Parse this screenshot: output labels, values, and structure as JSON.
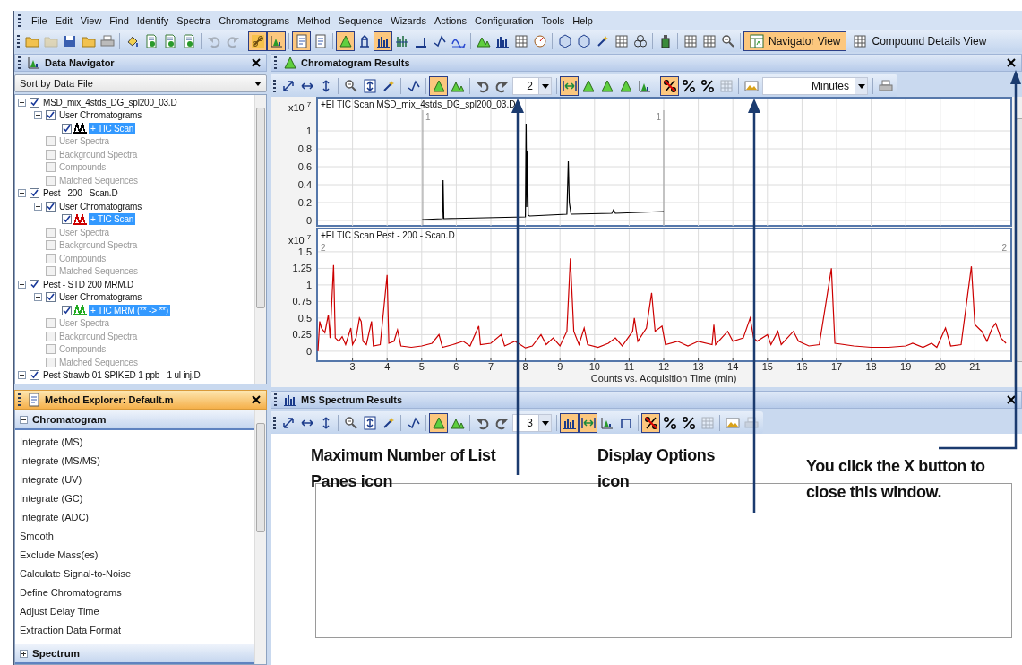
{
  "menu": [
    "File",
    "Edit",
    "View",
    "Find",
    "Identify",
    "Spectra",
    "Chromatograms",
    "Method",
    "Sequence",
    "Wizards",
    "Actions",
    "Configuration",
    "Tools",
    "Help"
  ],
  "main_toolbar": [
    {
      "items": [
        {
          "kind": "icon",
          "selected": false,
          "disabled": false
        },
        {
          "kind": "icon",
          "selected": false,
          "disabled": true
        },
        {
          "kind": "icon",
          "selected": false,
          "disabled": false
        },
        {
          "kind": "icon",
          "selected": false,
          "disabled": false
        },
        {
          "kind": "icon",
          "selected": false,
          "disabled": false
        }
      ]
    },
    {
      "items": [
        {
          "kind": "icon",
          "selected": false,
          "disabled": false
        },
        {
          "kind": "icon",
          "selected": false,
          "disabled": false
        },
        {
          "kind": "icon",
          "selected": false,
          "disabled": false
        },
        {
          "kind": "icon",
          "selected": false,
          "disabled": false
        }
      ]
    },
    {
      "items": [
        {
          "kind": "icon",
          "selected": false,
          "disabled": true
        },
        {
          "kind": "icon",
          "selected": false,
          "disabled": true
        }
      ]
    },
    {
      "items": [
        {
          "kind": "icon",
          "selected": true,
          "disabled": false
        },
        {
          "kind": "icon",
          "selected": true,
          "disabled": false
        }
      ]
    },
    {
      "items": [
        {
          "kind": "icon",
          "selected": true,
          "disabled": false
        },
        {
          "kind": "icon",
          "selected": false,
          "disabled": false
        }
      ]
    },
    {
      "items": [
        {
          "kind": "icon",
          "selected": true,
          "disabled": false
        },
        {
          "kind": "icon",
          "selected": false,
          "disabled": false
        },
        {
          "kind": "icon",
          "selected": true,
          "disabled": false
        },
        {
          "kind": "icon",
          "selected": false,
          "disabled": false
        },
        {
          "kind": "icon",
          "selected": false,
          "disabled": false
        },
        {
          "kind": "icon",
          "selected": false,
          "disabled": false
        },
        {
          "kind": "icon",
          "selected": false,
          "disabled": false
        }
      ]
    },
    {
      "items": [
        {
          "kind": "icon",
          "selected": false,
          "disabled": false
        },
        {
          "kind": "icon",
          "selected": false,
          "disabled": false
        },
        {
          "kind": "icon",
          "selected": false,
          "disabled": false
        },
        {
          "kind": "icon",
          "selected": false,
          "disabled": false
        }
      ]
    },
    {
      "items": [
        {
          "kind": "icon",
          "selected": false,
          "disabled": false
        },
        {
          "kind": "icon",
          "selected": false,
          "disabled": false
        },
        {
          "kind": "icon",
          "selected": false,
          "disabled": false
        },
        {
          "kind": "icon",
          "selected": false,
          "disabled": false
        },
        {
          "kind": "icon",
          "selected": false,
          "disabled": false
        }
      ]
    },
    {
      "items": [
        {
          "kind": "icon",
          "selected": false,
          "disabled": false
        }
      ]
    },
    {
      "items": [
        {
          "kind": "icon",
          "selected": false,
          "disabled": false
        },
        {
          "kind": "icon",
          "selected": false,
          "disabled": false
        },
        {
          "kind": "icon",
          "selected": false,
          "disabled": false
        }
      ]
    },
    {
      "items": [
        {
          "kind": "button",
          "label": "Navigator View",
          "selected": true
        },
        {
          "kind": "button",
          "label": "Compound Details View",
          "selected": false
        }
      ]
    }
  ],
  "data_navigator": {
    "title": "Data Navigator",
    "active": false,
    "sort": "Sort by Data File",
    "files": [
      {
        "label": "MSD_mix_4stds_DG_spl200_03.D",
        "checked": true,
        "expanded": true,
        "selected": false,
        "disabled": false,
        "children": [
          {
            "label": "User Chromatograms",
            "checked": true,
            "expanded": true,
            "selected": false,
            "disabled": false,
            "children": [
              {
                "label": "+ TIC Scan",
                "checked": true,
                "selected": true,
                "disabled": false,
                "color": "#000000"
              }
            ]
          },
          {
            "label": "User Spectra",
            "checked": false,
            "selected": false,
            "disabled": true
          },
          {
            "label": "Background Spectra",
            "checked": false,
            "selected": false,
            "disabled": true
          },
          {
            "label": "Compounds",
            "checked": false,
            "selected": false,
            "disabled": true
          },
          {
            "label": "Matched Sequences",
            "checked": false,
            "selected": false,
            "disabled": true
          }
        ]
      },
      {
        "label": "Pest - 200 - Scan.D",
        "checked": true,
        "expanded": true,
        "selected": false,
        "disabled": false,
        "children": [
          {
            "label": "User Chromatograms",
            "checked": true,
            "expanded": true,
            "selected": false,
            "disabled": false,
            "children": [
              {
                "label": "+ TIC Scan",
                "checked": true,
                "selected": true,
                "disabled": false,
                "color": "#cc0000"
              }
            ]
          },
          {
            "label": "User Spectra",
            "checked": false,
            "selected": false,
            "disabled": true
          },
          {
            "label": "Background Spectra",
            "checked": false,
            "selected": false,
            "disabled": true
          },
          {
            "label": "Compounds",
            "checked": false,
            "selected": false,
            "disabled": true
          },
          {
            "label": "Matched Sequences",
            "checked": false,
            "selected": false,
            "disabled": true
          }
        ]
      },
      {
        "label": "Pest - STD 200 MRM.D",
        "checked": true,
        "expanded": true,
        "selected": false,
        "disabled": false,
        "children": [
          {
            "label": "User Chromatograms",
            "checked": true,
            "expanded": true,
            "selected": false,
            "disabled": false,
            "children": [
              {
                "label": "+ TIC MRM (** -> **)",
                "checked": true,
                "selected": true,
                "disabled": false,
                "color": "#22aa22"
              }
            ]
          },
          {
            "label": "User Spectra",
            "checked": false,
            "selected": false,
            "disabled": true
          },
          {
            "label": "Background Spectra",
            "checked": false,
            "selected": false,
            "disabled": true
          },
          {
            "label": "Compounds",
            "checked": false,
            "selected": false,
            "disabled": true
          },
          {
            "label": "Matched Sequences",
            "checked": false,
            "selected": false,
            "disabled": true
          }
        ]
      },
      {
        "label": "Pest Strawb-01 SPIKED 1 ppb - 1 ul inj.D",
        "checked": true,
        "expanded": true,
        "selected": false,
        "disabled": false
      }
    ]
  },
  "method_explorer": {
    "title": "Method Explorer: Default.m",
    "active": true,
    "sections": [
      {
        "title": "Chromatogram",
        "expanded": true,
        "items": [
          "Integrate (MS)",
          "Integrate (MS/MS)",
          "Integrate (UV)",
          "Integrate (GC)",
          "Integrate (ADC)",
          "Smooth",
          "Exclude Mass(es)",
          "Calculate Signal-to-Noise",
          "Define Chromatograms",
          "Adjust Delay Time",
          "Extraction Data Format"
        ]
      },
      {
        "title": "Spectrum",
        "expanded": false
      }
    ]
  },
  "chromatogram_results": {
    "title": "Chromatogram Results",
    "active": false,
    "toolbar": [
      {
        "items": [
          {
            "kind": "icon",
            "selected": false,
            "disabled": false
          },
          {
            "kind": "icon",
            "selected": false,
            "disabled": false
          },
          {
            "kind": "icon",
            "selected": false,
            "disabled": false
          }
        ]
      },
      {
        "items": [
          {
            "kind": "icon",
            "selected": false,
            "disabled": false
          },
          {
            "kind": "icon",
            "selected": false,
            "disabled": false
          },
          {
            "kind": "icon",
            "selected": false,
            "disabled": false
          }
        ]
      },
      {
        "items": [
          {
            "kind": "icon",
            "selected": false,
            "disabled": false
          }
        ]
      },
      {
        "items": [
          {
            "kind": "icon",
            "selected": true,
            "disabled": false
          },
          {
            "kind": "icon",
            "selected": false,
            "disabled": false
          }
        ]
      },
      {
        "items": [
          {
            "kind": "icon",
            "selected": false,
            "disabled": false
          },
          {
            "kind": "icon",
            "selected": false,
            "disabled": false
          },
          {
            "kind": "dropdown",
            "value": "2"
          }
        ]
      },
      {
        "items": [
          {
            "kind": "icon",
            "selected": true,
            "disabled": false
          },
          {
            "kind": "icon",
            "selected": false,
            "disabled": false
          },
          {
            "kind": "icon",
            "selected": false,
            "disabled": false
          },
          {
            "kind": "icon",
            "selected": false,
            "disabled": false
          },
          {
            "kind": "icon",
            "selected": false,
            "disabled": false
          }
        ]
      },
      {
        "items": [
          {
            "kind": "icon",
            "selected": true,
            "disabled": false
          },
          {
            "kind": "icon",
            "selected": false,
            "disabled": false
          },
          {
            "kind": "icon",
            "selected": false,
            "disabled": false
          },
          {
            "kind": "icon",
            "selected": false,
            "disabled": true
          }
        ]
      },
      {
        "items": [
          {
            "kind": "icon",
            "selected": false,
            "disabled": false
          },
          {
            "kind": "dropdown",
            "value": "Minutes"
          }
        ]
      },
      {
        "items": [
          {
            "kind": "icon",
            "selected": false,
            "disabled": false
          }
        ]
      }
    ],
    "plots": [
      {
        "chart_data": {
          "type": "line",
          "title": "+EI TIC Scan MSD_mix_4stds_DG_spl200_03.D",
          "ylabel": "x10 $^{7}$",
          "grid": true,
          "xlim": [
            2,
            22
          ],
          "ylim": [
            -0.06,
            1.37
          ],
          "yticks": [
            0,
            0.2,
            0.4,
            0.6,
            0.8,
            1
          ],
          "x": [
            5.03,
            5.03,
            5.6,
            5.62,
            5.64,
            5.67,
            8.0,
            8.02,
            8.04,
            8.06,
            8.08,
            8.12,
            9.2,
            9.24,
            9.27,
            9.32,
            10.5,
            10.55,
            10.6,
            12.0
          ],
          "series": [
            {
              "color": "#000000",
              "values": [
                0,
                0.01,
                0.02,
                0.45,
                0.02,
                0.02,
                0.04,
                1.08,
                0.15,
                0.78,
                0.06,
                0.05,
                0.07,
                0.66,
                0.2,
                0.07,
                0.08,
                0.12,
                0.08,
                0.1
              ]
            }
          ],
          "annotations": [
            "1",
            "1"
          ]
        }
      },
      {
        "chart_data": {
          "type": "line",
          "title": "+EI TIC Scan Pest - 200 - Scan.D",
          "ylabel": "x10 $^{7}$",
          "xlabel": "Counts vs. Acquisition Time (min)",
          "grid": true,
          "xlim": [
            2,
            22
          ],
          "ylim": [
            -0.15,
            1.85
          ],
          "yticks": [
            0,
            0.25,
            0.5,
            0.75,
            1,
            1.25,
            1.5
          ],
          "xticks": [
            3,
            4,
            5,
            6,
            7,
            8,
            9,
            10,
            11,
            12,
            13,
            14,
            15,
            16,
            17,
            18,
            19,
            20,
            21
          ],
          "x": [
            2.0,
            2.05,
            2.1,
            2.2,
            2.3,
            2.35,
            2.45,
            2.5,
            2.6,
            2.7,
            2.8,
            2.95,
            3.0,
            3.1,
            3.2,
            3.25,
            3.3,
            3.4,
            3.55,
            3.6,
            3.8,
            4.0,
            4.05,
            4.2,
            4.3,
            4.4,
            4.7,
            5.0,
            5.3,
            5.5,
            5.6,
            5.9,
            6.2,
            6.4,
            6.65,
            6.7,
            7.0,
            7.3,
            7.4,
            7.7,
            8.0,
            8.2,
            8.45,
            8.6,
            8.8,
            9.0,
            9.2,
            9.3,
            9.4,
            9.55,
            9.7,
            9.8,
            10.1,
            10.4,
            10.6,
            10.8,
            11.1,
            11.15,
            11.25,
            11.5,
            11.65,
            11.75,
            11.95,
            12.05,
            12.4,
            12.7,
            13.0,
            13.4,
            13.45,
            13.5,
            13.85,
            14.0,
            14.3,
            14.5,
            14.6,
            14.7,
            15.0,
            15.1,
            15.3,
            15.4,
            15.75,
            15.9,
            16.2,
            16.5,
            16.85,
            16.95,
            17.5,
            18.0,
            18.5,
            19.0,
            19.2,
            19.5,
            19.75,
            19.9,
            20.15,
            20.3,
            20.6,
            20.9,
            21.0,
            21.2,
            21.35,
            21.5,
            21.6,
            21.75,
            21.9
          ],
          "series": [
            {
              "color": "#cc0000",
              "values": [
                0.0,
                0.45,
                0.35,
                0.28,
                0.55,
                0.2,
                1.3,
                0.2,
                0.15,
                0.22,
                0.1,
                0.35,
                0.1,
                0.2,
                0.5,
                0.45,
                0.15,
                0.1,
                0.45,
                0.08,
                0.1,
                1.15,
                0.12,
                0.15,
                0.32,
                0.08,
                0.06,
                0.08,
                0.12,
                0.25,
                0.06,
                0.1,
                0.15,
                0.08,
                0.38,
                0.1,
                0.12,
                0.25,
                0.08,
                0.15,
                0.05,
                0.08,
                0.25,
                0.1,
                0.2,
                0.08,
                0.3,
                1.4,
                0.3,
                0.1,
                0.35,
                0.1,
                0.06,
                0.12,
                0.2,
                0.08,
                0.3,
                0.5,
                0.15,
                0.35,
                0.88,
                0.3,
                0.38,
                0.1,
                0.15,
                0.08,
                0.15,
                0.1,
                0.4,
                0.1,
                0.3,
                0.15,
                0.2,
                0.5,
                0.2,
                0.15,
                0.25,
                0.1,
                0.3,
                0.1,
                0.3,
                0.15,
                0.08,
                0.1,
                1.25,
                0.12,
                0.08,
                0.06,
                0.06,
                0.08,
                0.12,
                0.06,
                0.12,
                0.06,
                0.35,
                0.08,
                0.1,
                1.28,
                0.4,
                0.3,
                0.15,
                0.35,
                0.42,
                0.2,
                0.12
              ]
            }
          ],
          "annotations": [
            "2",
            "2"
          ]
        }
      }
    ]
  },
  "ms_spectrum_results": {
    "title": "MS Spectrum Results",
    "active": false,
    "toolbar": [
      {
        "items": [
          {
            "kind": "icon",
            "selected": false,
            "disabled": false
          },
          {
            "kind": "icon",
            "selected": false,
            "disabled": false
          },
          {
            "kind": "icon",
            "selected": false,
            "disabled": false
          }
        ]
      },
      {
        "items": [
          {
            "kind": "icon",
            "selected": false,
            "disabled": false
          },
          {
            "kind": "icon",
            "selected": false,
            "disabled": false
          },
          {
            "kind": "icon",
            "selected": false,
            "disabled": false
          }
        ]
      },
      {
        "items": [
          {
            "kind": "icon",
            "selected": false,
            "disabled": false
          }
        ]
      },
      {
        "items": [
          {
            "kind": "icon",
            "selected": true,
            "disabled": false
          },
          {
            "kind": "icon",
            "selected": false,
            "disabled": false
          }
        ]
      },
      {
        "items": [
          {
            "kind": "icon",
            "selected": false,
            "disabled": false
          },
          {
            "kind": "icon",
            "selected": false,
            "disabled": false
          },
          {
            "kind": "dropdown",
            "value": "3"
          }
        ]
      },
      {
        "items": [
          {
            "kind": "icon",
            "selected": true,
            "disabled": false
          },
          {
            "kind": "icon",
            "selected": true,
            "disabled": false
          },
          {
            "kind": "icon",
            "selected": false,
            "disabled": false
          },
          {
            "kind": "icon",
            "selected": false,
            "disabled": false
          }
        ]
      },
      {
        "items": [
          {
            "kind": "icon",
            "selected": true,
            "disabled": false
          },
          {
            "kind": "icon",
            "selected": false,
            "disabled": false
          },
          {
            "kind": "icon",
            "selected": false,
            "disabled": false
          },
          {
            "kind": "icon",
            "selected": false,
            "disabled": true
          }
        ]
      },
      {
        "items": [
          {
            "kind": "icon",
            "selected": false,
            "disabled": false
          },
          {
            "kind": "icon",
            "selected": false,
            "disabled": true
          }
        ]
      }
    ]
  },
  "callouts": [
    {
      "text": "Maximum Number of List Panes icon"
    },
    {
      "text": "Display Options icon"
    },
    {
      "text": "You click the X button to close this window."
    }
  ]
}
